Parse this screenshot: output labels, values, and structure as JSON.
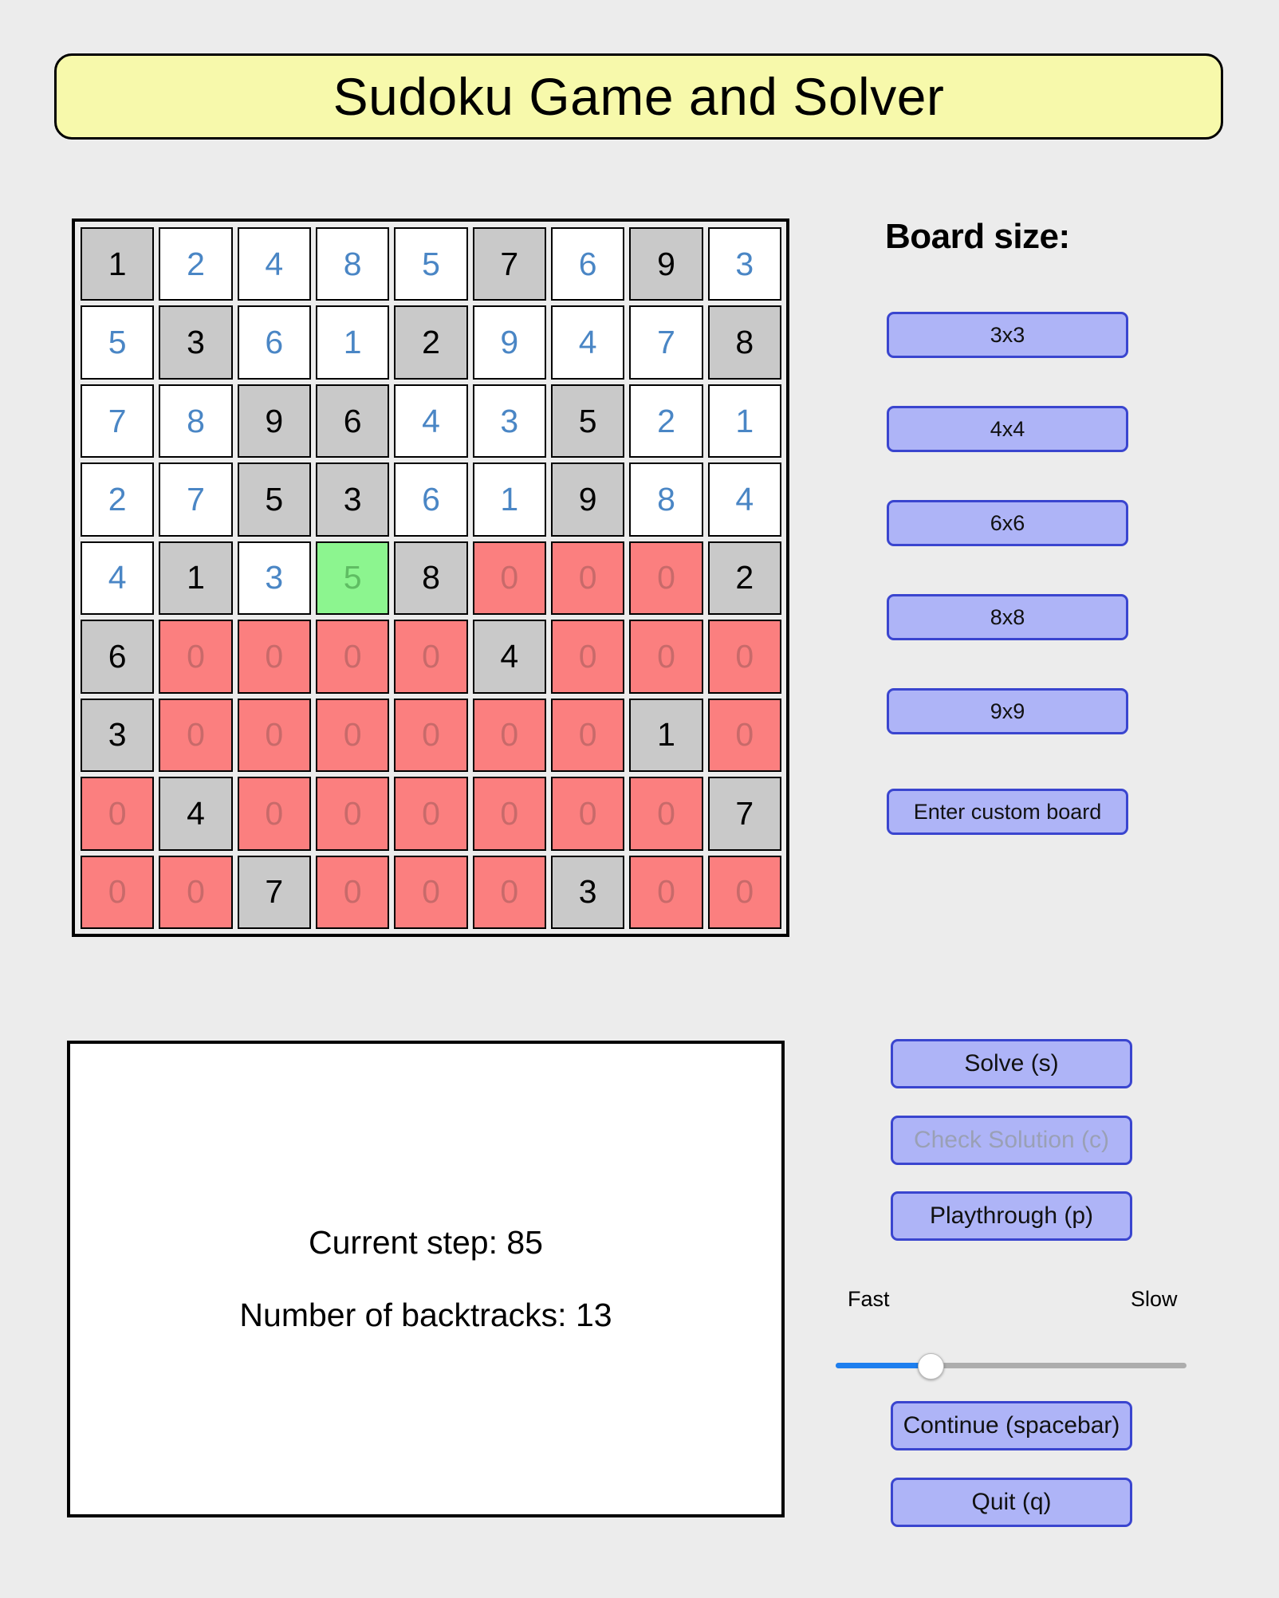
{
  "app": {
    "title": "Sudoku Game and Solver"
  },
  "board": {
    "rows": 9,
    "cols": 9,
    "cells": [
      [
        {
          "v": "1",
          "s": "fixed"
        },
        {
          "v": "2",
          "s": "solved"
        },
        {
          "v": "4",
          "s": "solved"
        },
        {
          "v": "8",
          "s": "solved"
        },
        {
          "v": "5",
          "s": "solved"
        },
        {
          "v": "7",
          "s": "fixed"
        },
        {
          "v": "6",
          "s": "solved"
        },
        {
          "v": "9",
          "s": "fixed"
        },
        {
          "v": "3",
          "s": "solved"
        }
      ],
      [
        {
          "v": "5",
          "s": "solved"
        },
        {
          "v": "3",
          "s": "fixed"
        },
        {
          "v": "6",
          "s": "solved"
        },
        {
          "v": "1",
          "s": "solved"
        },
        {
          "v": "2",
          "s": "fixed"
        },
        {
          "v": "9",
          "s": "solved"
        },
        {
          "v": "4",
          "s": "solved"
        },
        {
          "v": "7",
          "s": "solved"
        },
        {
          "v": "8",
          "s": "fixed"
        }
      ],
      [
        {
          "v": "7",
          "s": "solved"
        },
        {
          "v": "8",
          "s": "solved"
        },
        {
          "v": "9",
          "s": "fixed"
        },
        {
          "v": "6",
          "s": "fixed"
        },
        {
          "v": "4",
          "s": "solved"
        },
        {
          "v": "3",
          "s": "solved"
        },
        {
          "v": "5",
          "s": "fixed"
        },
        {
          "v": "2",
          "s": "solved"
        },
        {
          "v": "1",
          "s": "solved"
        }
      ],
      [
        {
          "v": "2",
          "s": "solved"
        },
        {
          "v": "7",
          "s": "solved"
        },
        {
          "v": "5",
          "s": "fixed"
        },
        {
          "v": "3",
          "s": "fixed"
        },
        {
          "v": "6",
          "s": "solved"
        },
        {
          "v": "1",
          "s": "solved"
        },
        {
          "v": "9",
          "s": "fixed"
        },
        {
          "v": "8",
          "s": "solved"
        },
        {
          "v": "4",
          "s": "solved"
        }
      ],
      [
        {
          "v": "4",
          "s": "solved"
        },
        {
          "v": "1",
          "s": "fixed"
        },
        {
          "v": "3",
          "s": "solved"
        },
        {
          "v": "5",
          "s": "active"
        },
        {
          "v": "8",
          "s": "fixed"
        },
        {
          "v": "0",
          "s": "empty"
        },
        {
          "v": "0",
          "s": "empty"
        },
        {
          "v": "0",
          "s": "empty"
        },
        {
          "v": "2",
          "s": "fixed"
        }
      ],
      [
        {
          "v": "6",
          "s": "fixed"
        },
        {
          "v": "0",
          "s": "empty"
        },
        {
          "v": "0",
          "s": "empty"
        },
        {
          "v": "0",
          "s": "empty"
        },
        {
          "v": "0",
          "s": "empty"
        },
        {
          "v": "4",
          "s": "fixed"
        },
        {
          "v": "0",
          "s": "empty"
        },
        {
          "v": "0",
          "s": "empty"
        },
        {
          "v": "0",
          "s": "empty"
        }
      ],
      [
        {
          "v": "3",
          "s": "fixed"
        },
        {
          "v": "0",
          "s": "empty"
        },
        {
          "v": "0",
          "s": "empty"
        },
        {
          "v": "0",
          "s": "empty"
        },
        {
          "v": "0",
          "s": "empty"
        },
        {
          "v": "0",
          "s": "empty"
        },
        {
          "v": "0",
          "s": "empty"
        },
        {
          "v": "1",
          "s": "fixed"
        },
        {
          "v": "0",
          "s": "empty"
        }
      ],
      [
        {
          "v": "0",
          "s": "empty"
        },
        {
          "v": "4",
          "s": "fixed"
        },
        {
          "v": "0",
          "s": "empty"
        },
        {
          "v": "0",
          "s": "empty"
        },
        {
          "v": "0",
          "s": "empty"
        },
        {
          "v": "0",
          "s": "empty"
        },
        {
          "v": "0",
          "s": "empty"
        },
        {
          "v": "0",
          "s": "empty"
        },
        {
          "v": "7",
          "s": "fixed"
        }
      ],
      [
        {
          "v": "0",
          "s": "empty"
        },
        {
          "v": "0",
          "s": "empty"
        },
        {
          "v": "7",
          "s": "fixed"
        },
        {
          "v": "0",
          "s": "empty"
        },
        {
          "v": "0",
          "s": "empty"
        },
        {
          "v": "0",
          "s": "empty"
        },
        {
          "v": "3",
          "s": "fixed"
        },
        {
          "v": "0",
          "s": "empty"
        },
        {
          "v": "0",
          "s": "empty"
        }
      ]
    ]
  },
  "board_size": {
    "heading": "Board size:",
    "options": [
      "3x3",
      "4x4",
      "6x6",
      "8x8",
      "9x9"
    ],
    "custom_label": "Enter custom board"
  },
  "status": {
    "current_step": "Current step: 85",
    "backtracks": "Number of backtracks: 13"
  },
  "controls": {
    "solve": "Solve (s)",
    "check": "Check Solution (c)",
    "playthrough": "Playthrough (p)",
    "continue": "Continue (spacebar)",
    "quit": "Quit (q)",
    "speed_fast": "Fast",
    "speed_slow": "Slow",
    "speed_value": 27
  },
  "colors": {
    "page_bg": "#ececec",
    "title_bg": "#f7f9ab",
    "button_bg": "#aeb4f7",
    "button_border": "#3a45cf",
    "cell_fixed_bg": "#c9c9c9",
    "cell_solved_text": "#4a86c5",
    "cell_empty_bg": "#fb7f7f",
    "cell_active_bg": "#8cf58f",
    "slider_fill": "#1e7fef"
  }
}
